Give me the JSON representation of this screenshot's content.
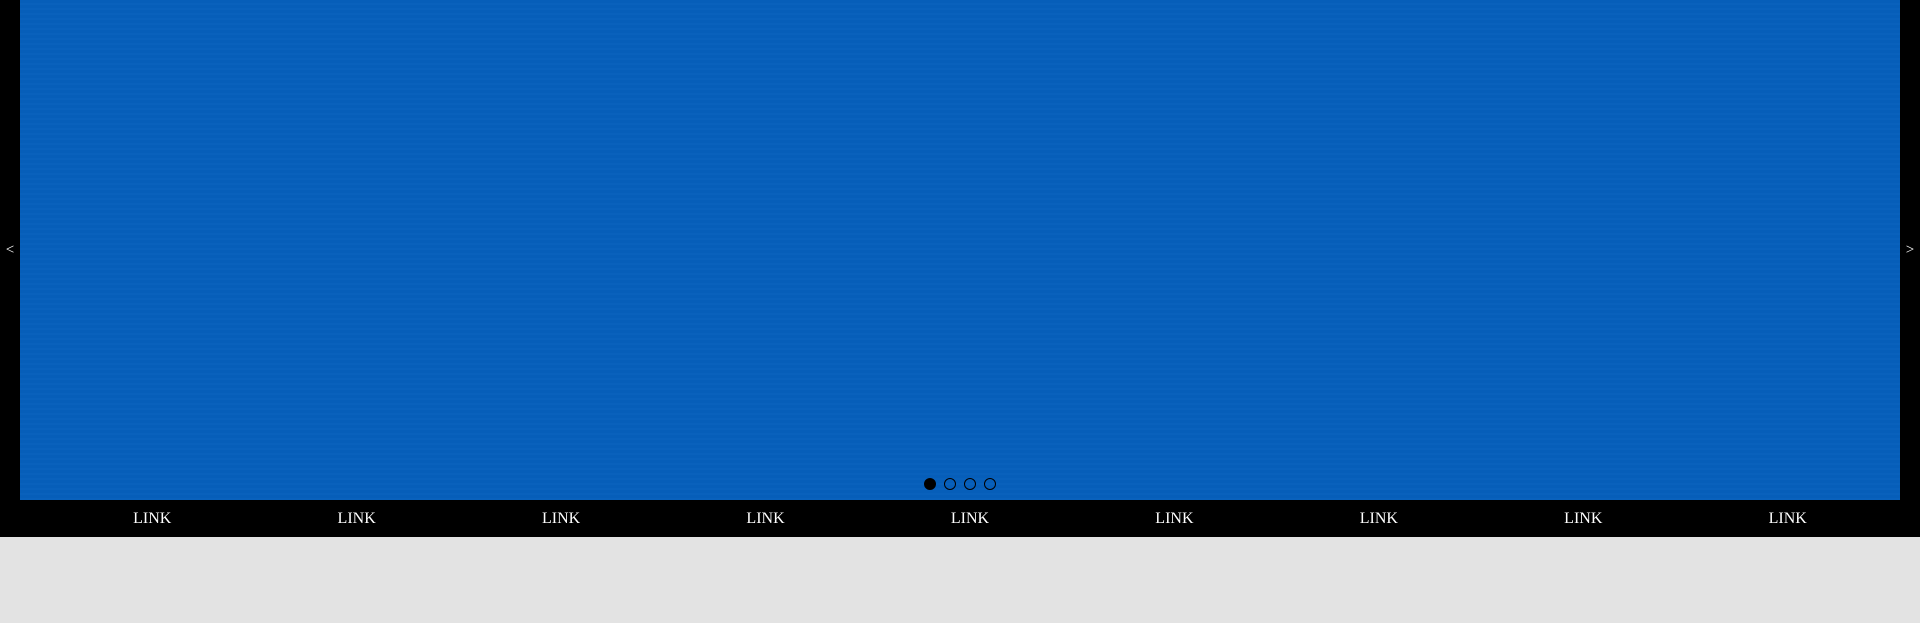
{
  "carousel": {
    "prev_label": "<",
    "next_label": ">",
    "slide_color": "#065fbb",
    "frame_color": "#000000",
    "dots": [
      {
        "active": true
      },
      {
        "active": false
      },
      {
        "active": false
      },
      {
        "active": false
      }
    ]
  },
  "nav": {
    "links": [
      {
        "label": "LINK"
      },
      {
        "label": "LINK"
      },
      {
        "label": "LINK"
      },
      {
        "label": "LINK"
      },
      {
        "label": "LINK"
      },
      {
        "label": "LINK"
      },
      {
        "label": "LINK"
      },
      {
        "label": "LINK"
      },
      {
        "label": "LINK"
      }
    ]
  },
  "page": {
    "background_color": "#e3e3e3"
  }
}
